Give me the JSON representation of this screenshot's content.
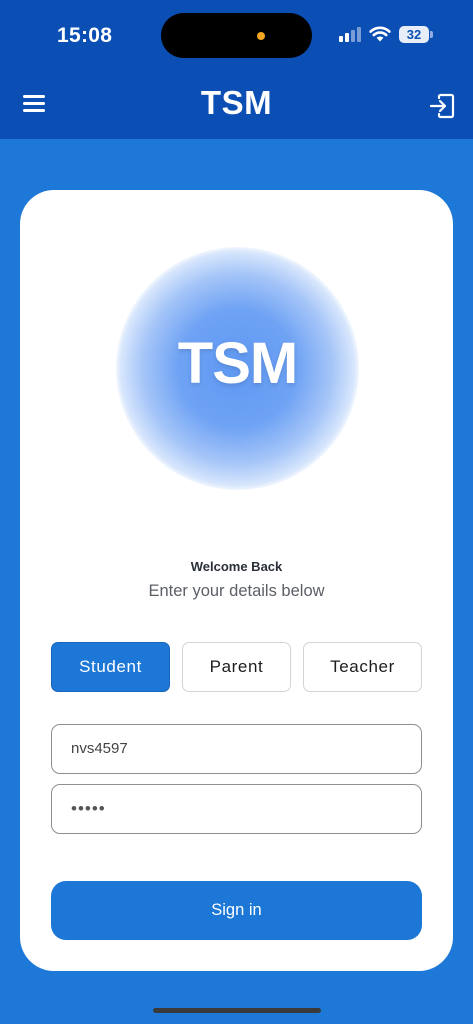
{
  "status_bar": {
    "time": "15:08",
    "battery": "32"
  },
  "header": {
    "title": "TSM"
  },
  "logo": {
    "text": "TSM"
  },
  "welcome": {
    "title": "Welcome Back",
    "subtitle": "Enter your details below"
  },
  "roles": {
    "selected": "Student",
    "options": [
      "Student",
      "Parent",
      "Teacher"
    ]
  },
  "form": {
    "username_value": "nvs4597",
    "password_value": "•••••",
    "signin_label": "Sign in"
  },
  "colors": {
    "header_bg": "#0b4fb5",
    "page_bg": "#1e78d8",
    "accent": "#1c77d6"
  },
  "icons": {
    "menu": "hamburger-menu-icon",
    "logout": "logout-icon",
    "signal": "cellular-signal-icon",
    "wifi": "wifi-icon",
    "battery": "battery-icon"
  }
}
